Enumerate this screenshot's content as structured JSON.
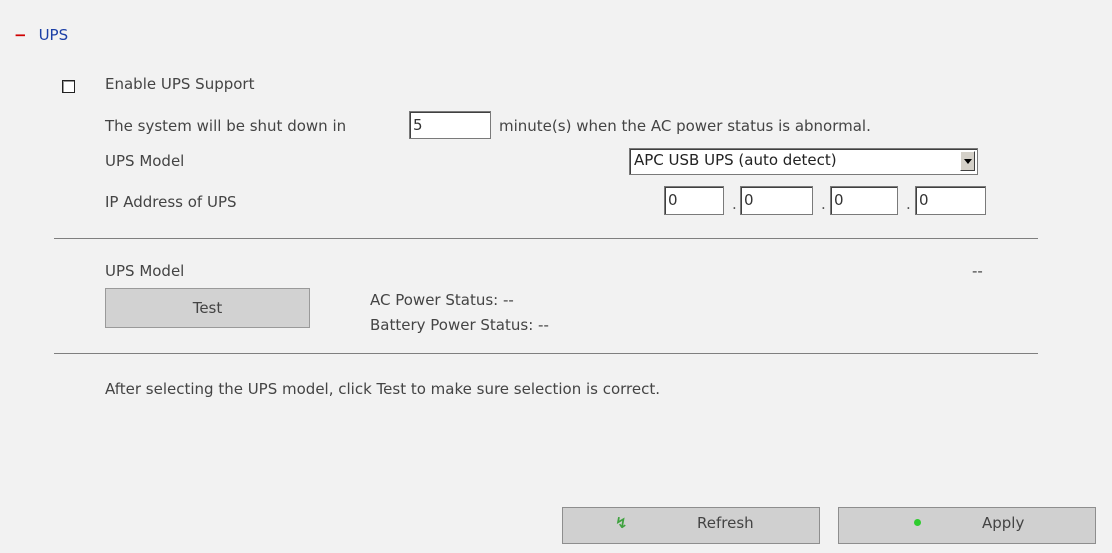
{
  "section": {
    "title": "UPS",
    "toggle_symbol": "−"
  },
  "enable_ups": {
    "label": "Enable UPS Support",
    "checked": false
  },
  "shutdown": {
    "prefix": "The system will be shut down in",
    "minutes": "5",
    "suffix": "minute(s) when the AC power status is abnormal."
  },
  "ups_model": {
    "label": "UPS Model",
    "selected": "APC USB UPS (auto detect)"
  },
  "ip_address": {
    "label": "IP Address of UPS",
    "octets": [
      "0",
      "0",
      "0",
      "0"
    ],
    "separator": "."
  },
  "status": {
    "model_label": "UPS Model",
    "model_value": "--",
    "test_button": "Test",
    "ac_power": "AC Power Status: --",
    "battery_power": "Battery Power Status: --"
  },
  "hint": "After selecting the UPS model, click Test to make sure selection is correct.",
  "buttons": {
    "refresh": "Refresh",
    "apply": "Apply"
  },
  "colors": {
    "background": "#f2f2f2",
    "section_title": "#1b3fa6",
    "collapse_minus": "#d00000",
    "apply_dot": "#2fcc2f",
    "refresh_icon": "#3fa23f"
  }
}
